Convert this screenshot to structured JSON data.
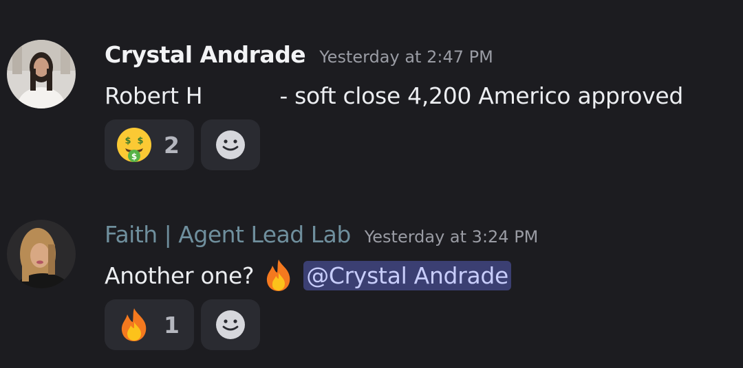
{
  "messages": [
    {
      "author": "Crystal Andrade",
      "timestamp": "Yesterday at 2:47 PM",
      "text_before_redaction": "Robert H",
      "text_after_redaction": "- soft close 4,200 Americo approved",
      "reactions": [
        {
          "emoji": "money-mouth-face",
          "count": "2"
        }
      ],
      "add_reaction_icon": "add-reaction-smiley-icon"
    },
    {
      "author": "Faith | Agent Lead Lab",
      "author_color": "#6f8f9d",
      "timestamp": "Yesterday at 3:24 PM",
      "text": "Another one?",
      "inline_emoji": "fire",
      "mention": "@Crystal Andrade",
      "reactions": [
        {
          "emoji": "fire",
          "count": "1"
        }
      ],
      "add_reaction_icon": "add-reaction-smiley-icon"
    }
  ],
  "colors": {
    "background": "#1c1c20",
    "reaction_bg": "#2a2b31",
    "mention_bg": "#3b3f72",
    "mention_text": "#c8cdfb",
    "timestamp": "#9a9ca4"
  }
}
